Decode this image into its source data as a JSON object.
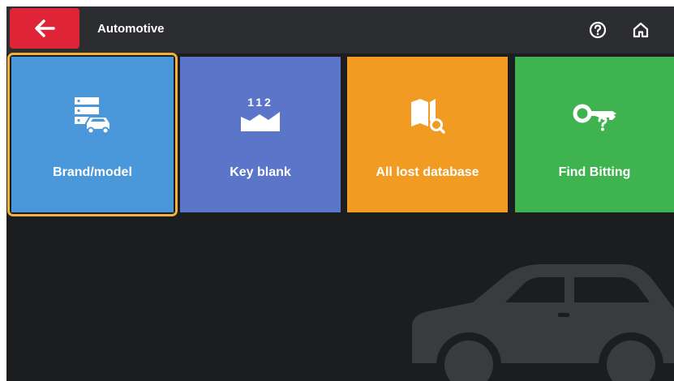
{
  "header": {
    "title": "Automotive",
    "back_icon": "arrow-left-icon",
    "help_icon": "question-circle-icon",
    "home_icon": "home-icon"
  },
  "tiles": [
    {
      "label": "Brand/model",
      "icon": "database-car-icon",
      "color": "#4a98d9",
      "selected": true
    },
    {
      "label": "Key blank",
      "icon": "key-blank-icon",
      "icon_text": "112",
      "color": "#5b75c8",
      "selected": false
    },
    {
      "label": "All lost database",
      "icon": "book-search-icon",
      "color": "#f19b22",
      "selected": false
    },
    {
      "label": "Find Bitting",
      "icon": "key-question-icon",
      "color": "#3fb34f",
      "selected": false
    }
  ],
  "colors": {
    "back_button": "#e02437",
    "topbar": "#2c2d30",
    "background": "#1c1d1f",
    "selection": "#f4b13a"
  },
  "decor": {
    "background_icon": "car-silhouette-icon"
  }
}
